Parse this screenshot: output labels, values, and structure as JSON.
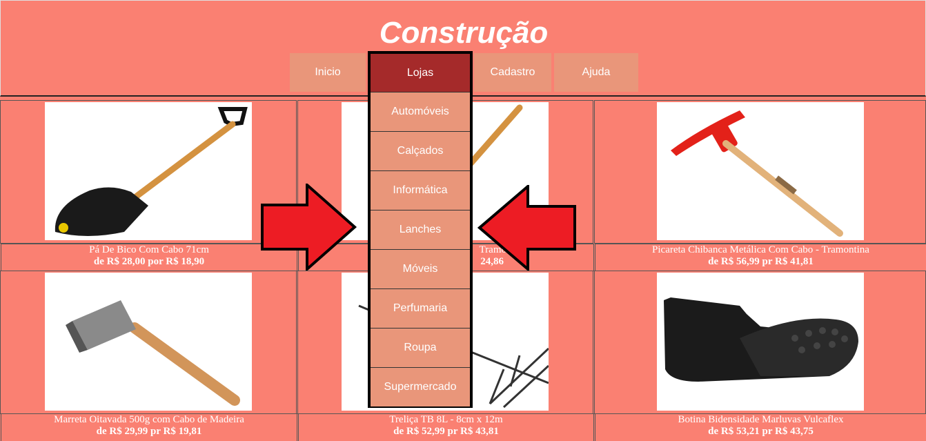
{
  "header": {
    "title": "Construção",
    "nav": {
      "inicio": "Inicio",
      "lojas": "Lojas",
      "cadastro": "Cadastro",
      "ajuda": "Ajuda"
    }
  },
  "dropdown": {
    "items": [
      "Automóveis",
      "Calçados",
      "Informática",
      "Lanches",
      "Móveis",
      "Perfumaria",
      "Roupa",
      "Supermercado"
    ]
  },
  "products": [
    {
      "name": "Pá De Bico Com Cabo 71cm",
      "price": "de R$ 28,00 por R$ 18,90"
    },
    {
      "name": "Tramontina",
      "price": "24,86"
    },
    {
      "name": "Picareta Chibanca Metálica Com Cabo - Tramontina",
      "price": "de R$ 56,99 pr R$ 41,81"
    },
    {
      "name": "Marreta Oitavada 500g com Cabo de Madeira",
      "price": "de R$ 29,99 pr R$ 19,81"
    },
    {
      "name": "Treliça TB 8L - 8cm x 12m",
      "price": "de R$ 52,99 pr R$ 43,81"
    },
    {
      "name": "Botina Bidensidade Marluvas Vulcaflex",
      "price": "de R$ 53,21 pr R$ 43,75"
    }
  ],
  "colors": {
    "background": "#fa8072",
    "nav_button": "#e9967a",
    "active_menu": "#a52a2a",
    "arrow": "#ed1c24"
  },
  "icons": [
    "shovel-image",
    "hoe-image",
    "pickaxe-image",
    "sledgehammer-image",
    "truss-image",
    "boot-image",
    "left-arrow-annotation",
    "right-arrow-annotation"
  ]
}
